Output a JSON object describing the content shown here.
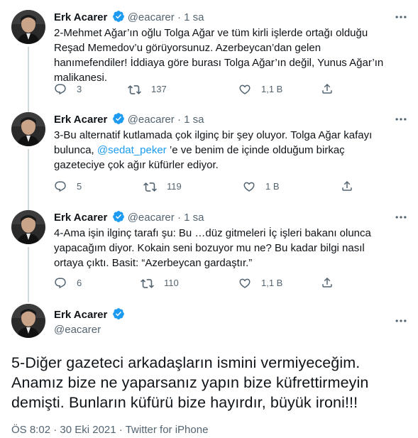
{
  "author": {
    "name": "Erk Acarer",
    "handle": "@eacarer"
  },
  "separator": "·",
  "colors": {
    "verified": "#1d9bf0",
    "mention": "#1d9bf0",
    "muted": "#536471"
  },
  "tweets": [
    {
      "time": "1 sa",
      "text_parts": [
        "2-Mehmet Ağar’ın oğlu Tolga Ağar ve tüm kirli işlerde ortağı olduğu Reşad Memedov’u görüyorsunuz. Azerbeycan’dan gelen hanımefendiler! İddiaya göre burası Tolga Ağar’ın değil, Yunus Ağar’ın malikanesi."
      ],
      "replies": "3",
      "retweets": "137",
      "likes": "1,1 B"
    },
    {
      "time": "1 sa",
      "text_before": "3-Bu alternatif kutlamada çok ilginç bir şey oluyor. Tolga Ağar kafayı bulunca, ",
      "mention": "@sedat_peker",
      "text_after": " ’e ve benim de içinde olduğum birkaç gazeteciye çok ağır küfürler ediyor.",
      "replies": "5",
      "retweets": "119",
      "likes": "1 B"
    },
    {
      "time": "1 sa",
      "text_parts": [
        "4-Ama işin ilginç tarafı şu: Bu …düz gitmeleri İç işleri bakanı olunca yapacağım diyor. Kokain seni bozuyor mu ne? Bu kadar bilgi nasıl ortaya çıktı. Basit: “Azerbeycan gardaştır.”"
      ],
      "replies": "6",
      "retweets": "110",
      "likes": "1,1 B"
    }
  ],
  "main_tweet": {
    "text": "5-Diğer gazeteci arkadaşların ismini vermiyeceğim. Anamız bize ne yaparsanız yapın bize küfrettirmeyin demişti. Bunların küfürü bize hayırdır, büyük ironi!!!",
    "time": "ÖS 8:02",
    "date": "30 Eki 2021",
    "source": "Twitter for iPhone"
  },
  "icons": {
    "reply": "reply-icon",
    "retweet": "retweet-icon",
    "like": "heart-icon",
    "share": "share-icon",
    "verified": "verified-badge-icon",
    "more": "more-options-icon"
  }
}
